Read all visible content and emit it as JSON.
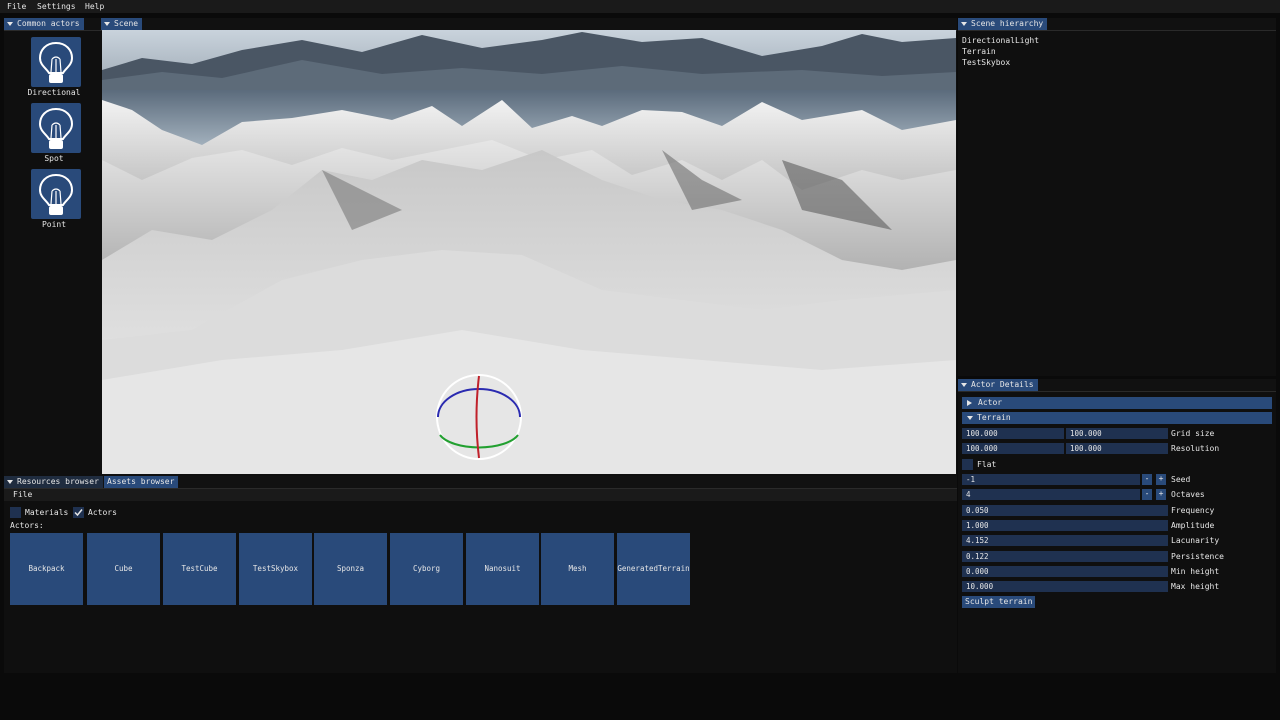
{
  "menu": {
    "file": "File",
    "settings": "Settings",
    "help": "Help"
  },
  "common_actors": {
    "title": "Common actors",
    "items": [
      {
        "label": "Directional",
        "icon": "light-bulb-icon"
      },
      {
        "label": "Spot",
        "icon": "light-bulb-icon"
      },
      {
        "label": "Point",
        "icon": "light-bulb-icon"
      }
    ]
  },
  "scene": {
    "title": "Scene"
  },
  "hierarchy": {
    "title": "Scene hierarchy",
    "items": [
      "DirectionalLight",
      "Terrain",
      "TestSkybox"
    ]
  },
  "details": {
    "title": "Actor Details",
    "actor_section": "Actor",
    "terrain_section": "Terrain",
    "grid_size": {
      "x": "100.000",
      "y": "100.000",
      "label": "Grid size"
    },
    "resolution": {
      "x": "100.000",
      "y": "100.000",
      "label": "Resolution"
    },
    "flat": {
      "label": "Flat",
      "checked": false
    },
    "seed": {
      "value": "-1",
      "label": "Seed"
    },
    "octaves": {
      "value": "4",
      "label": "Octaves"
    },
    "frequency": {
      "value": "0.050",
      "label": "Frequency"
    },
    "amplitude": {
      "value": "1.000",
      "label": "Amplitude"
    },
    "lacunarity": {
      "value": "4.152",
      "label": "Lacunarity"
    },
    "persistence": {
      "value": "0.122",
      "label": "Persistence"
    },
    "min_height": {
      "value": "0.000",
      "label": "Min height"
    },
    "max_height": {
      "value": "10.000",
      "label": "Max height"
    },
    "minus": "-",
    "plus": "+",
    "sculpt_button": "Sculpt terrain"
  },
  "resources": {
    "tab_resources": "Resources browser",
    "tab_assets": "Assets browser",
    "menu_file": "File",
    "materials": {
      "label": "Materials",
      "checked": false
    },
    "actors": {
      "label": "Actors",
      "checked": true
    },
    "actors_header": "Actors:",
    "assets": [
      "Backpack",
      "Cube",
      "TestCube",
      "TestSkybox",
      "Sponza",
      "Cyborg",
      "Nanosuit",
      "Mesh",
      "GeneratedTerrain"
    ]
  },
  "colors": {
    "accent": "#294a7a",
    "frame_bg": "#1f3150",
    "window_bg": "#0f0f0f",
    "gizmo_red": "#c0202a",
    "gizmo_green": "#22a030",
    "gizmo_blue": "#2a2ab0"
  }
}
